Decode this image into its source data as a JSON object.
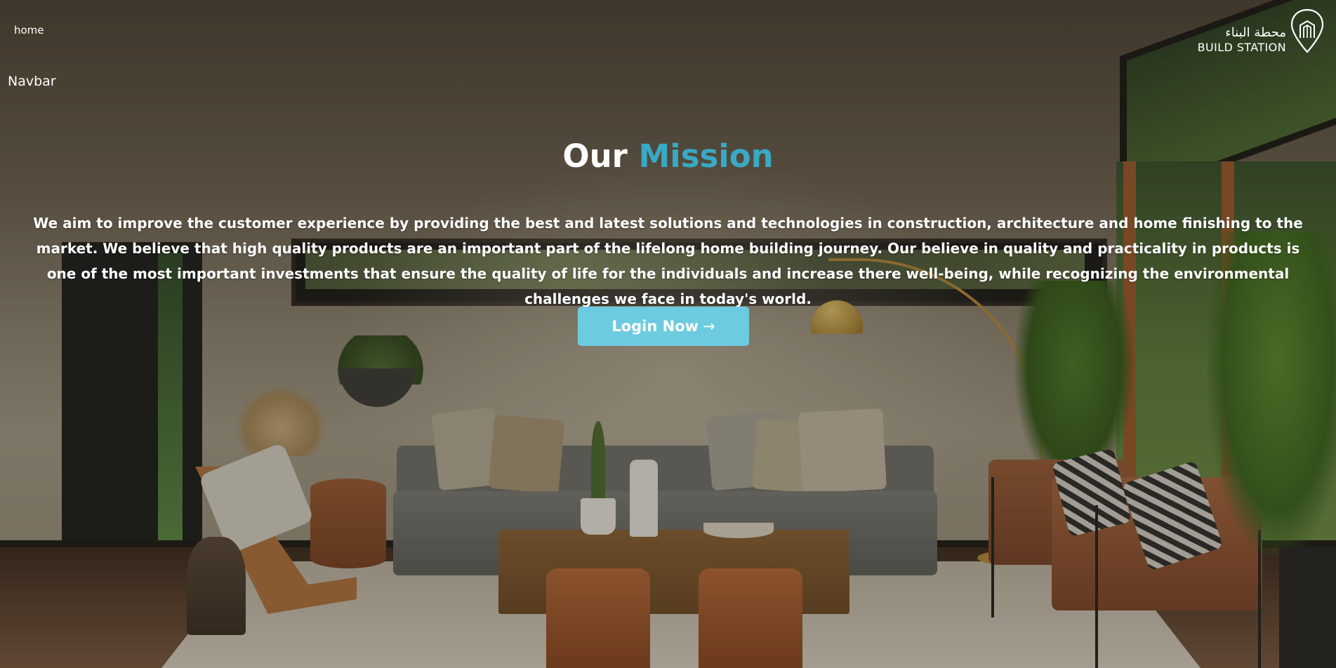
{
  "nav": {
    "home_link": "home",
    "navbar_label": "Navbar"
  },
  "logo": {
    "arabic_name": "محطة البناء",
    "english_name": "BUILD STATION",
    "icon": "building-location-pin-icon"
  },
  "hero": {
    "title_part1": "Our",
    "title_part2": "Mission",
    "description": "We aim to improve the customer experience by providing the best and latest solutions and technologies in construction, architecture and home finishing to the market. We believe that high quality products are an important part of the lifelong home building journey. Our believe in quality and practicality in products is one of the most important investments that ensure the quality of life for the individuals and increase there well-being, while recognizing the environmental challenges we face in today's world.",
    "cta_label": "Login Now",
    "cta_icon": "arrow-right-icon",
    "cta_arrow": "→"
  },
  "colors": {
    "accent": "#39a9c5",
    "button_bg": "#6dcbe0",
    "text": "#ffffff"
  }
}
